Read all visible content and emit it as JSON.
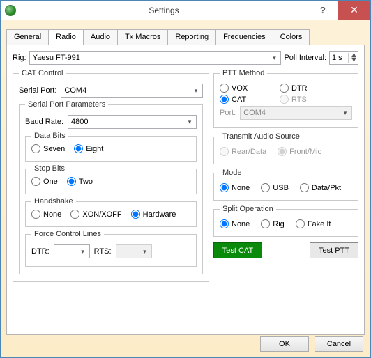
{
  "window": {
    "title": "Settings"
  },
  "tabs": [
    "General",
    "Radio",
    "Audio",
    "Tx Macros",
    "Reporting",
    "Frequencies",
    "Colors"
  ],
  "active_tab": 1,
  "rig": {
    "label": "Rig:",
    "value": "Yaesu FT-991"
  },
  "poll": {
    "label": "Poll Interval:",
    "value": "1 s"
  },
  "cat": {
    "legend": "CAT Control",
    "serial_port": {
      "label": "Serial Port:",
      "value": "COM4"
    },
    "params_legend": "Serial Port Parameters",
    "baud": {
      "label": "Baud Rate:",
      "value": "4800"
    },
    "databits": {
      "legend": "Data Bits",
      "seven": "Seven",
      "eight": "Eight",
      "selected": "eight"
    },
    "stopbits": {
      "legend": "Stop Bits",
      "one": "One",
      "two": "Two",
      "selected": "two"
    },
    "handshake": {
      "legend": "Handshake",
      "none": "None",
      "xon": "XON/XOFF",
      "hw": "Hardware",
      "selected": "hw"
    },
    "force": {
      "legend": "Force Control Lines",
      "dtr": "DTR:",
      "rts": "RTS:",
      "dtr_val": "",
      "rts_val": ""
    }
  },
  "ptt": {
    "legend": "PTT Method",
    "vox": "VOX",
    "dtr": "DTR",
    "cat": "CAT",
    "rts": "RTS",
    "selected": "cat",
    "port_label": "Port:",
    "port_value": "COM4"
  },
  "txaudio": {
    "legend": "Transmit Audio Source",
    "rear": "Rear/Data",
    "front": "Front/Mic"
  },
  "mode": {
    "legend": "Mode",
    "none": "None",
    "usb": "USB",
    "dpkt": "Data/Pkt",
    "selected": "none"
  },
  "split": {
    "legend": "Split Operation",
    "none": "None",
    "rig": "Rig",
    "fake": "Fake It",
    "selected": "none"
  },
  "buttons": {
    "testcat": "Test CAT",
    "testptt": "Test PTT",
    "ok": "OK",
    "cancel": "Cancel"
  }
}
